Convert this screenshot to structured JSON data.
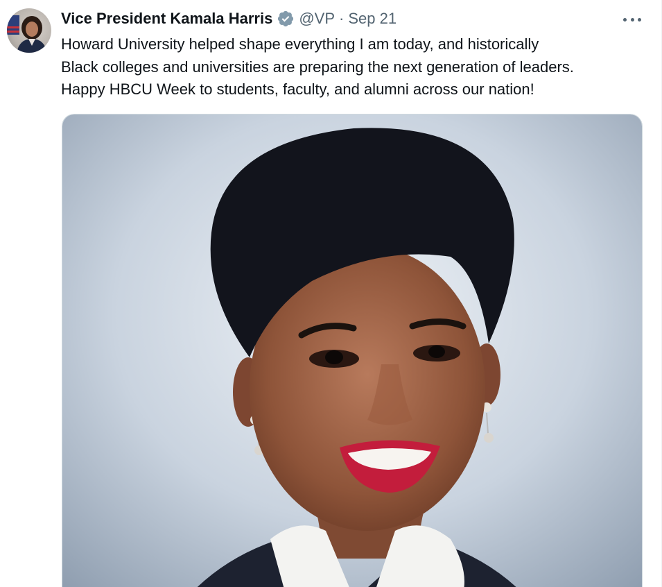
{
  "tweet": {
    "author": {
      "display_name": "Vice President Kamala Harris",
      "handle": "@VP",
      "separator": "·",
      "date": "Sep 21",
      "verified_icon": "verified-badge-icon",
      "avatar_icon": "profile-avatar"
    },
    "text_lines": [
      "Howard University helped shape everything I am today, and historically",
      "Black colleges and universities are preparing the next generation of leaders.",
      "Happy HBCU Week to students, faculty, and alumni across our nation!"
    ],
    "more_icon": "more-options-icon",
    "media": {
      "type": "photo",
      "description_icon": "portrait-photo"
    }
  },
  "colors": {
    "text_primary": "#0f1419",
    "text_secondary": "#536471",
    "verified_badge": "#829aab",
    "media_border": "#cfd9de"
  }
}
